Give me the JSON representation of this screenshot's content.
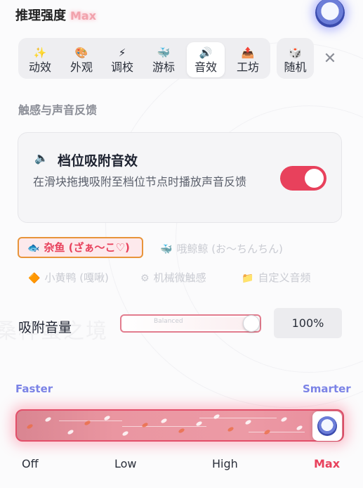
{
  "header": {
    "title": "推理强度",
    "level_badge": "Max"
  },
  "tabs": [
    {
      "label": "动效",
      "icon": "sparkles-icon",
      "glyph": "✨"
    },
    {
      "label": "外观",
      "icon": "palette-icon",
      "glyph": "🎨"
    },
    {
      "label": "调校",
      "icon": "lightning-icon",
      "glyph": "⚡"
    },
    {
      "label": "游标",
      "icon": "cursor-icon",
      "glyph": "🐳"
    },
    {
      "label": "音效",
      "icon": "speaker-icon",
      "glyph": "🔊",
      "active": true
    },
    {
      "label": "工坊",
      "icon": "workshop-icon",
      "glyph": "📤"
    },
    {
      "label": "随机",
      "icon": "dice-icon",
      "glyph": "🎲"
    }
  ],
  "close_glyph": "✕",
  "section": {
    "title": "触感与声音反馈"
  },
  "snap_card": {
    "speaker_glyph": "🔈",
    "title": "档位吸附音效",
    "description": "在滑块拖拽吸附至档位节点时播放声音反馈",
    "enabled": true
  },
  "sound_options": [
    {
      "label": "杂鱼 (ざぁ～こ♡)",
      "icon": "fish-icon",
      "glyph": "🐟",
      "selected": true
    },
    {
      "label": "哦鲸鲸 (お～ちんちん)",
      "icon": "whale-icon",
      "glyph": "🐳",
      "selected": false
    },
    {
      "label": "小黄鸭 (嘎啾)",
      "icon": "duck-icon",
      "glyph": "🔶",
      "selected": false
    },
    {
      "label": "机械微触感",
      "icon": "gear-icon",
      "glyph": "⚙",
      "selected": false
    },
    {
      "label": "自定义音频",
      "icon": "folder-icon",
      "glyph": "📁",
      "selected": false
    }
  ],
  "volume": {
    "label": "吸附音量",
    "value_text": "100%",
    "value_fraction": 1.0,
    "tick_text": "Balanced"
  },
  "strength": {
    "left_caption": "Faster",
    "right_caption": "Smarter",
    "levels": [
      "Off",
      "Low",
      "High",
      "Max"
    ],
    "current_level": "Max"
  },
  "colors": {
    "accent": "#e8415c",
    "caption_blue": "#7b83e6",
    "selected_border": "#e8943a"
  }
}
